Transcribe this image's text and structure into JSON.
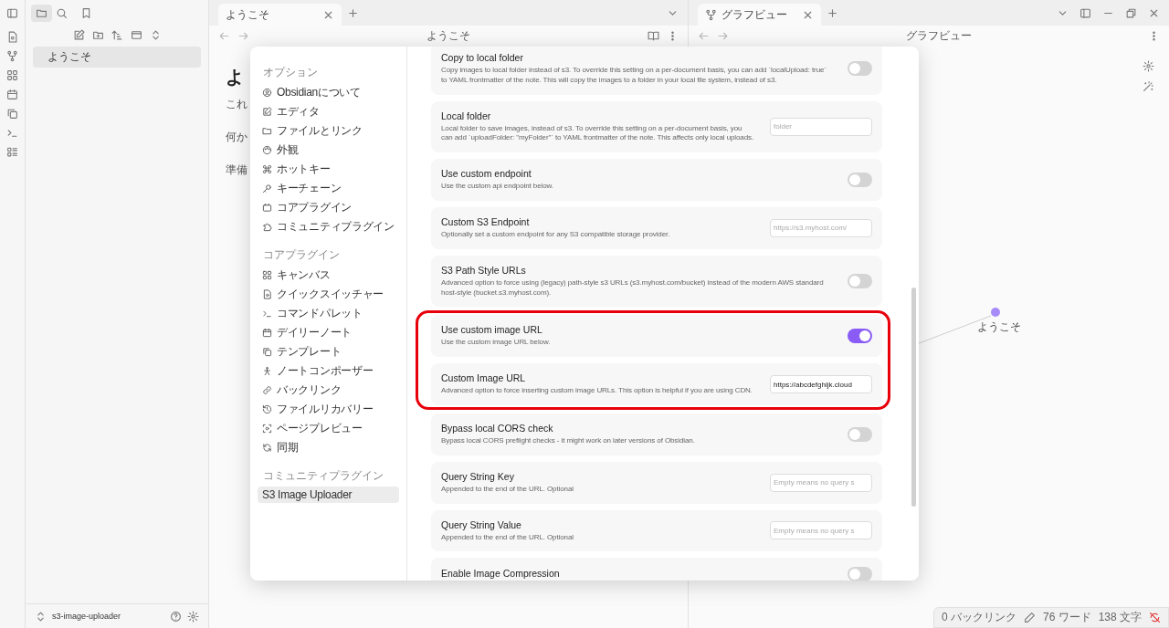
{
  "explorer": {
    "files": [
      {
        "name": "ようこそ",
        "selected": true
      }
    ],
    "vault": "s3-image-uploader"
  },
  "panes": [
    {
      "kind": "note",
      "tab": "ようこそ",
      "title": "ようこそ",
      "heading": "よ",
      "lines": [
        "これ",
        "何か",
        "準備"
      ]
    },
    {
      "kind": "graph",
      "tab": "グラフビュー",
      "title": "グラフビュー",
      "nodes": [
        {
          "label": "ようこそ"
        }
      ]
    }
  ],
  "status_bar": {
    "backlinks": "0 バックリンク",
    "words": "76 ワード",
    "chars": "138 文字"
  },
  "settings": {
    "sections": [
      {
        "heading": "オプション",
        "items": [
          {
            "label": "Obsidianについて",
            "selected": false
          },
          {
            "label": "エディタ",
            "selected": false
          },
          {
            "label": "ファイルとリンク",
            "selected": false
          },
          {
            "label": "外観",
            "selected": false
          },
          {
            "label": "ホットキー",
            "selected": false
          },
          {
            "label": "キーチェーン",
            "selected": false
          },
          {
            "label": "コアプラグイン",
            "selected": false
          },
          {
            "label": "コミュニティプラグイン",
            "selected": false
          }
        ]
      },
      {
        "heading": "コアプラグイン",
        "items": [
          {
            "label": "キャンバス",
            "selected": false
          },
          {
            "label": "クイックスイッチャー",
            "selected": false
          },
          {
            "label": "コマンドパレット",
            "selected": false
          },
          {
            "label": "デイリーノート",
            "selected": false
          },
          {
            "label": "テンプレート",
            "selected": false
          },
          {
            "label": "ノートコンポーザー",
            "selected": false
          },
          {
            "label": "バックリンク",
            "selected": false
          },
          {
            "label": "ファイルリカバリー",
            "selected": false
          },
          {
            "label": "ページプレビュー",
            "selected": false
          },
          {
            "label": "同期",
            "selected": false
          }
        ]
      },
      {
        "heading": "コミュニティプラグイン",
        "items": [
          {
            "label": "S3 Image Uploader",
            "selected": true
          }
        ]
      }
    ],
    "options": [
      {
        "kind": "toggle",
        "name": "Copy to local folder",
        "desc": "Copy images to local folder instead of s3. To override this setting on a per-document basis, you can add `localUpload: true` to YAML frontmatter of the note. This will copy the images to a folder in your local file system, instead of s3.",
        "on": false,
        "highlighted": false
      },
      {
        "kind": "text",
        "name": "Local folder",
        "desc": "Local folder to save images, instead of s3. To override this setting on a per-document basis, you can add `uploadFolder: \"myFolder\"` to YAML frontmatter of the note. This affects only local uploads.",
        "placeholder": "folder",
        "highlighted": false
      },
      {
        "kind": "toggle",
        "name": "Use custom endpoint",
        "desc": "Use the custom api endpoint below.",
        "on": false,
        "highlighted": false
      },
      {
        "kind": "text",
        "name": "Custom S3 Endpoint",
        "desc": "Optionally set a custom endpoint for any S3 compatible storage provider.",
        "placeholder": "https://s3.myhost.com/",
        "highlighted": false
      },
      {
        "kind": "toggle",
        "name": "S3 Path Style URLs",
        "desc": "Advanced option to force using (legacy) path-style s3 URLs (s3.myhost.com/bucket) instead of the modern AWS standard host-style (bucket.s3.myhost.com).",
        "on": false,
        "highlighted": false
      },
      {
        "kind": "toggle",
        "name": "Use custom image URL",
        "desc": "Use the custom image URL below.",
        "on": true,
        "highlighted": true
      },
      {
        "kind": "text",
        "name": "Custom Image URL",
        "desc": "Advanced option to force inserting custom image URLs. This option is helpful if you are using CDN.",
        "value": "https://abcdefghijk.cloud",
        "highlighted": true
      },
      {
        "kind": "toggle",
        "name": "Bypass local CORS check",
        "desc": "Bypass local CORS preflight checks - it might work on later versions of Obsidian.",
        "on": false,
        "highlighted": false
      },
      {
        "kind": "text",
        "name": "Query String Key",
        "desc": "Appended to the end of the URL. Optional",
        "placeholder": "Empty means no query s",
        "highlighted": false
      },
      {
        "kind": "text",
        "name": "Query String Value",
        "desc": "Appended to the end of the URL. Optional",
        "placeholder": "Empty means no query s",
        "highlighted": false
      },
      {
        "kind": "toggle",
        "name": "Enable Image Compression",
        "on": false,
        "highlighted": false
      }
    ]
  }
}
